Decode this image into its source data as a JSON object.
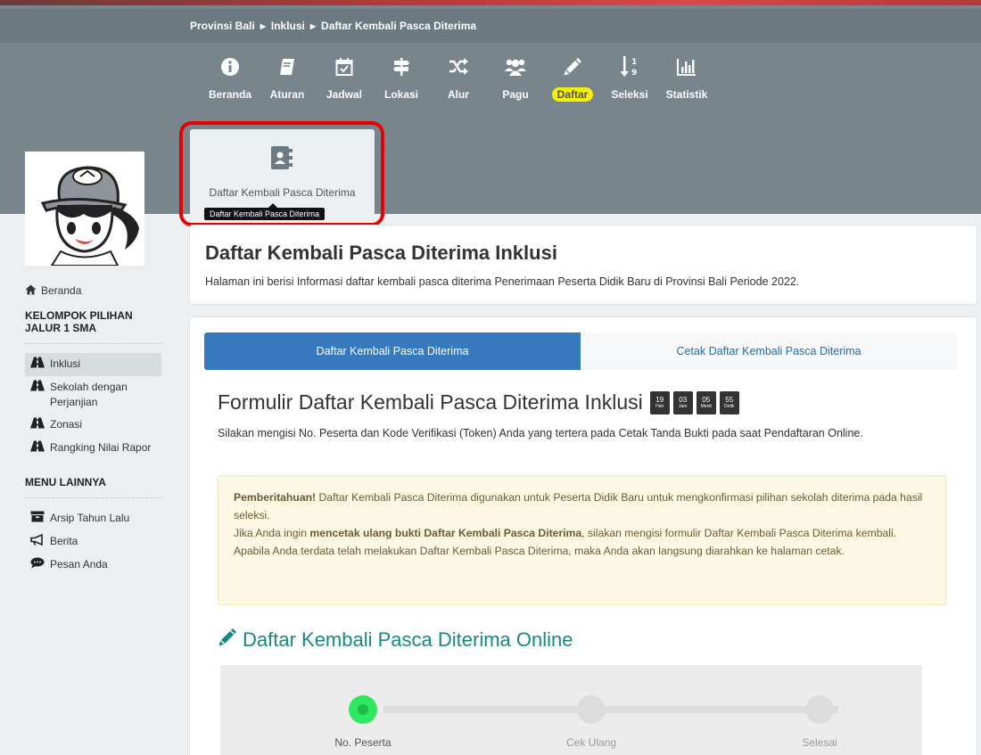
{
  "breadcrumb": [
    "Provinsi Bali",
    "Inklusi",
    "Daftar Kembali Pasca Diterima"
  ],
  "nav": [
    {
      "label": "Beranda",
      "icon": "info-circle-icon"
    },
    {
      "label": "Aturan",
      "icon": "book-icon"
    },
    {
      "label": "Jadwal",
      "icon": "calendar-check-icon"
    },
    {
      "label": "Lokasi",
      "icon": "signpost-icon"
    },
    {
      "label": "Alur",
      "icon": "shuffle-icon"
    },
    {
      "label": "Pagu",
      "icon": "users-icon"
    },
    {
      "label": "Daftar",
      "icon": "pencil-icon"
    },
    {
      "label": "Seleksi",
      "icon": "sort-numeric-icon"
    },
    {
      "label": "Statistik",
      "icon": "bar-chart-icon"
    }
  ],
  "active_nav": "Daftar",
  "subtab": {
    "label": "Daftar Kembali Pasca Diterima",
    "tooltip": "Daftar Kembali Pasca Diterima"
  },
  "sidebar": {
    "home": "Beranda",
    "group_heading": "KELOMPOK PILIHAN JALUR 1 SMA",
    "groups": [
      {
        "label": "Inklusi",
        "active": true
      },
      {
        "label": "Sekolah dengan Perjanjian",
        "active": false
      },
      {
        "label": "Zonasi",
        "active": false
      },
      {
        "label": "Rangking Nilai Rapor",
        "active": false
      }
    ],
    "other_heading": "MENU LAINNYA",
    "other": [
      {
        "label": "Arsip Tahun Lalu",
        "icon": "archive-icon"
      },
      {
        "label": "Berita",
        "icon": "bullhorn-icon"
      },
      {
        "label": "Pesan Anda",
        "icon": "comment-icon"
      }
    ]
  },
  "header": {
    "title": "Daftar Kembali Pasca Diterima Inklusi",
    "subtitle": "Halaman ini berisi Informasi daftar kembali pasca diterima Penerimaan Peserta Didik Baru di Provinsi Bali Periode 2022."
  },
  "tabs": [
    {
      "label": "Daftar Kembali Pasca Diterima",
      "active": true
    },
    {
      "label": "Cetak Daftar Kembali Pasca Diterima",
      "active": false
    }
  ],
  "form": {
    "title": "Formulir Daftar Kembali Pasca Diterima Inklusi",
    "countdown": [
      {
        "value": "19",
        "unit": "Hari"
      },
      {
        "value": "03",
        "unit": "Jam"
      },
      {
        "value": "05",
        "unit": "Menit"
      },
      {
        "value": "55",
        "unit": "Detik"
      }
    ],
    "description": "Silakan mengisi No. Peserta dan Kode Verifikasi (Token) Anda yang tertera pada Cetak Tanda Bukti pada saat Pendaftaran Online."
  },
  "notice": {
    "strong": "Pemberitahuan!",
    "line1": " Daftar Kembali Pasca Diterima digunakan untuk Peserta Didik Baru untuk mengkonfirmasi pilihan sekolah diterima pada hasil seleksi.",
    "line2_pre": "Jika Anda ingin ",
    "line2_strong": "mencetak ulang bukti Daftar Kembali Pasca Diterima",
    "line2_post": ", silakan mengisi formulir Daftar Kembali Pasca Diterima kembali. Apabila Anda terdata telah melakukan Daftar Kembali Pasca Diterima, maka Anda akan langsung diarahkan ke halaman cetak."
  },
  "online": {
    "title": "Daftar Kembali Pasca Diterima Online",
    "steps": [
      "No. Peserta",
      "Cek Ulang",
      "Selesai"
    ],
    "current_step": 0
  },
  "colors": {
    "primary": "#3779bd",
    "teal": "#158a81",
    "highlight": "#e20000",
    "nav_active": "#f4f000"
  }
}
